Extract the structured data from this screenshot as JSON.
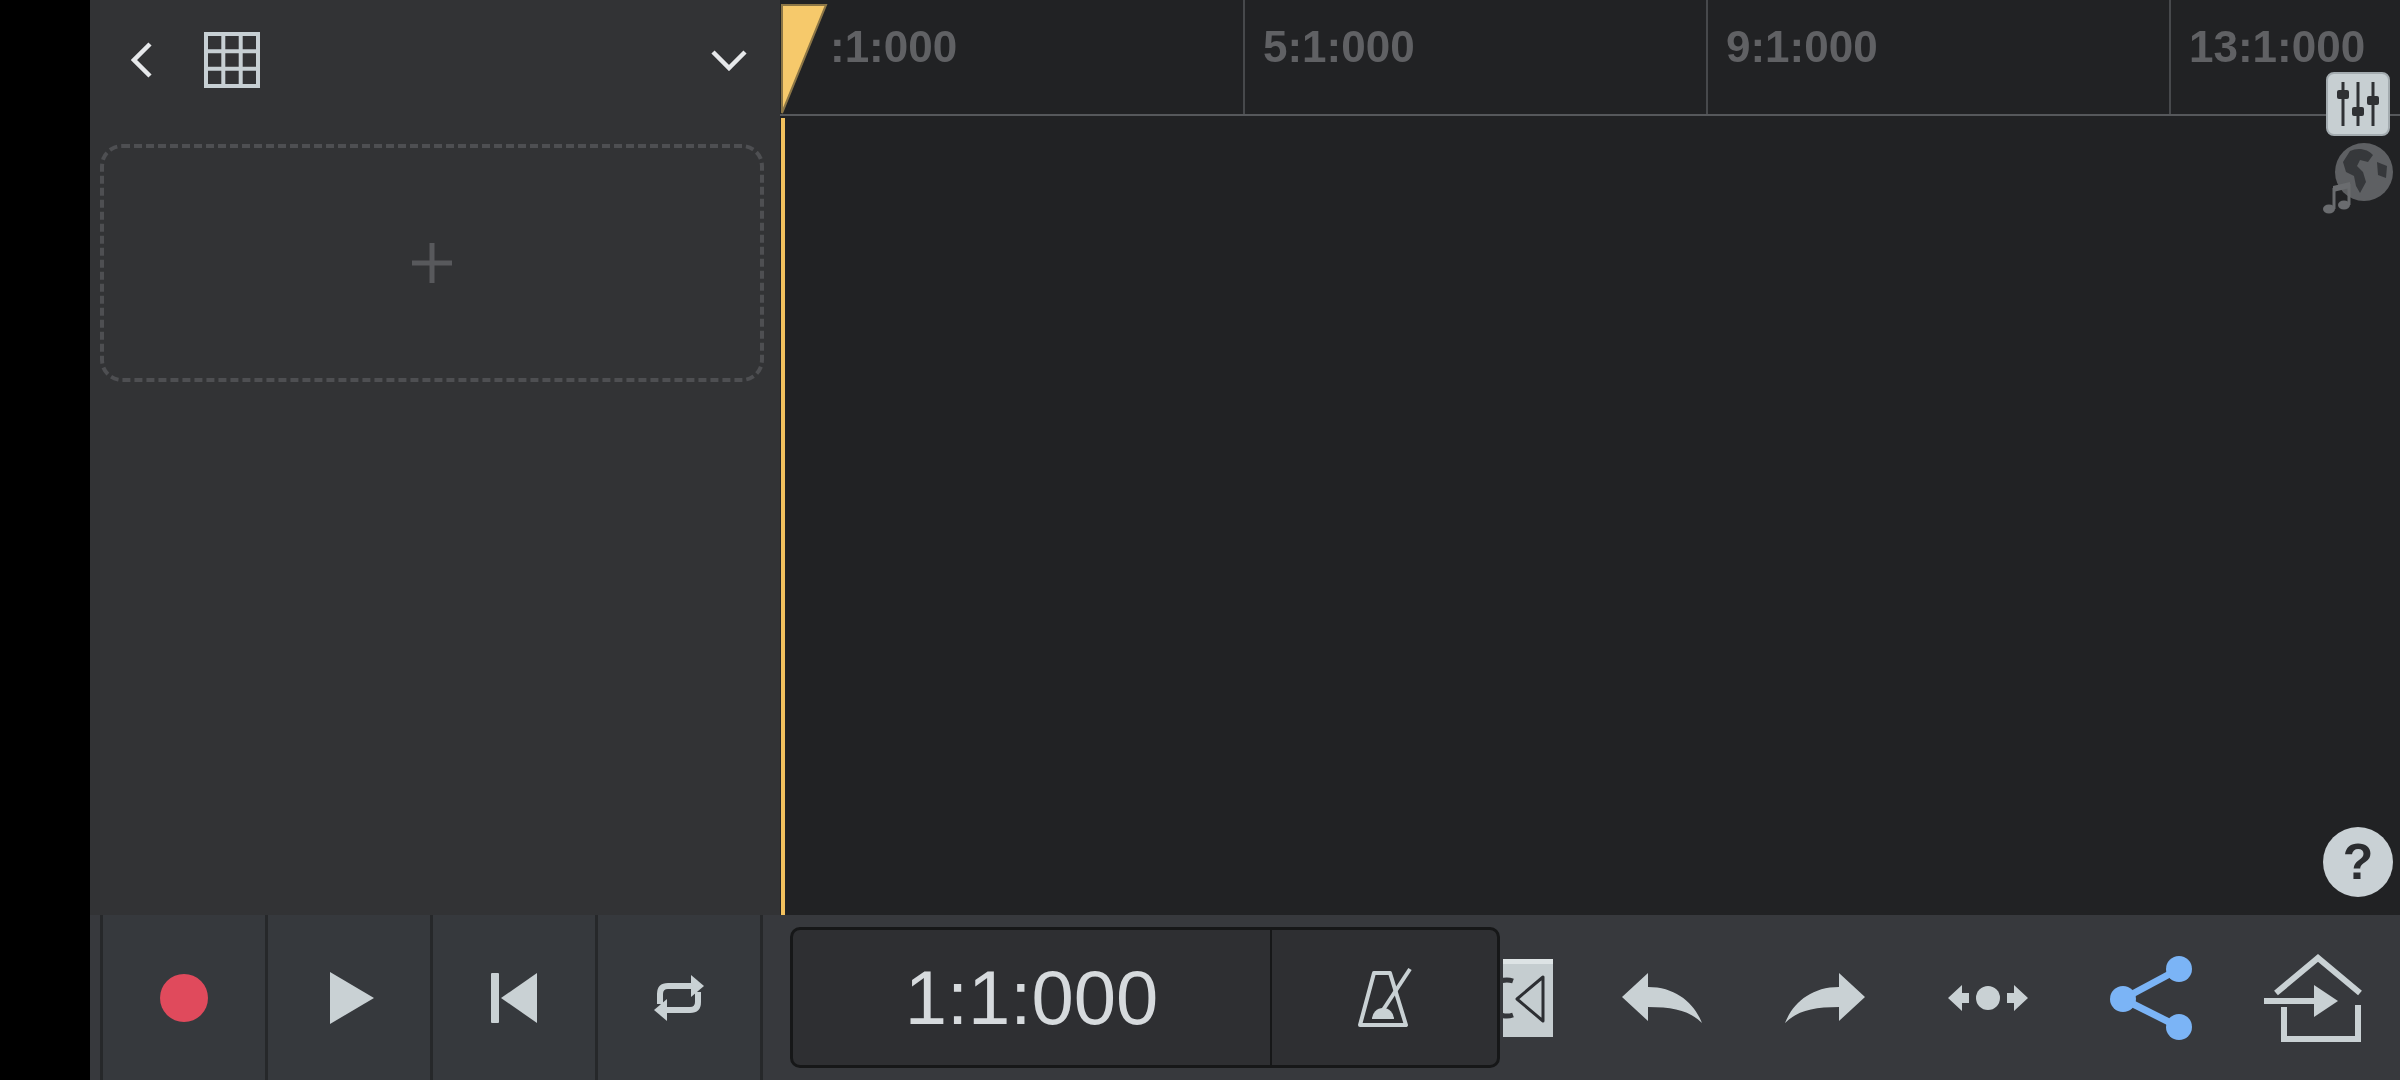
{
  "ruler": {
    "markers": [
      ":1:000",
      "5:1:000",
      "9:1:000",
      "13:1:000"
    ]
  },
  "time_display": {
    "position": "1:1:000"
  },
  "help_button": {
    "label": "?"
  }
}
